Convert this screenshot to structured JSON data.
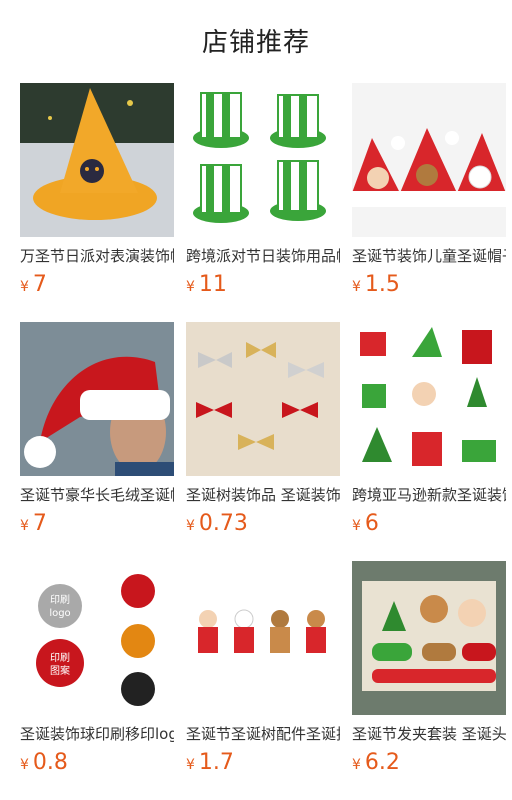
{
  "header": {
    "title": "店铺推荐"
  },
  "currency": "¥",
  "products": [
    {
      "name": "万圣节日派对表演装饰帽",
      "price": "7",
      "image": "orange-witch-hat"
    },
    {
      "name": "跨境派对节日装饰用品帽",
      "price": "11",
      "image": "green-striped-hats"
    },
    {
      "name": "圣诞节装饰儿童圣诞帽子",
      "price": "1.5",
      "image": "red-santa-hats"
    },
    {
      "name": "圣诞节豪华长毛绒圣诞帽",
      "price": "7",
      "image": "plush-santa-hat"
    },
    {
      "name": "圣诞树装饰品 圣诞装饰",
      "price": "0.73",
      "image": "bows"
    },
    {
      "name": "跨境亚马逊新款圣诞装饰",
      "price": "6",
      "image": "christmas-mix"
    },
    {
      "name": "圣诞装饰球印刷移印logo",
      "price": "0.8",
      "image": "ornament-balls"
    },
    {
      "name": "圣诞节圣诞树配件圣诞挂件",
      "price": "1.7",
      "image": "hanging-dolls"
    },
    {
      "name": "圣诞节发夹套装 圣诞头饰",
      "price": "6.2",
      "image": "hair-clips"
    }
  ],
  "ornament_labels": {
    "silver_ball": "印刷\nlogo",
    "red_ball": "印刷\n图案"
  }
}
